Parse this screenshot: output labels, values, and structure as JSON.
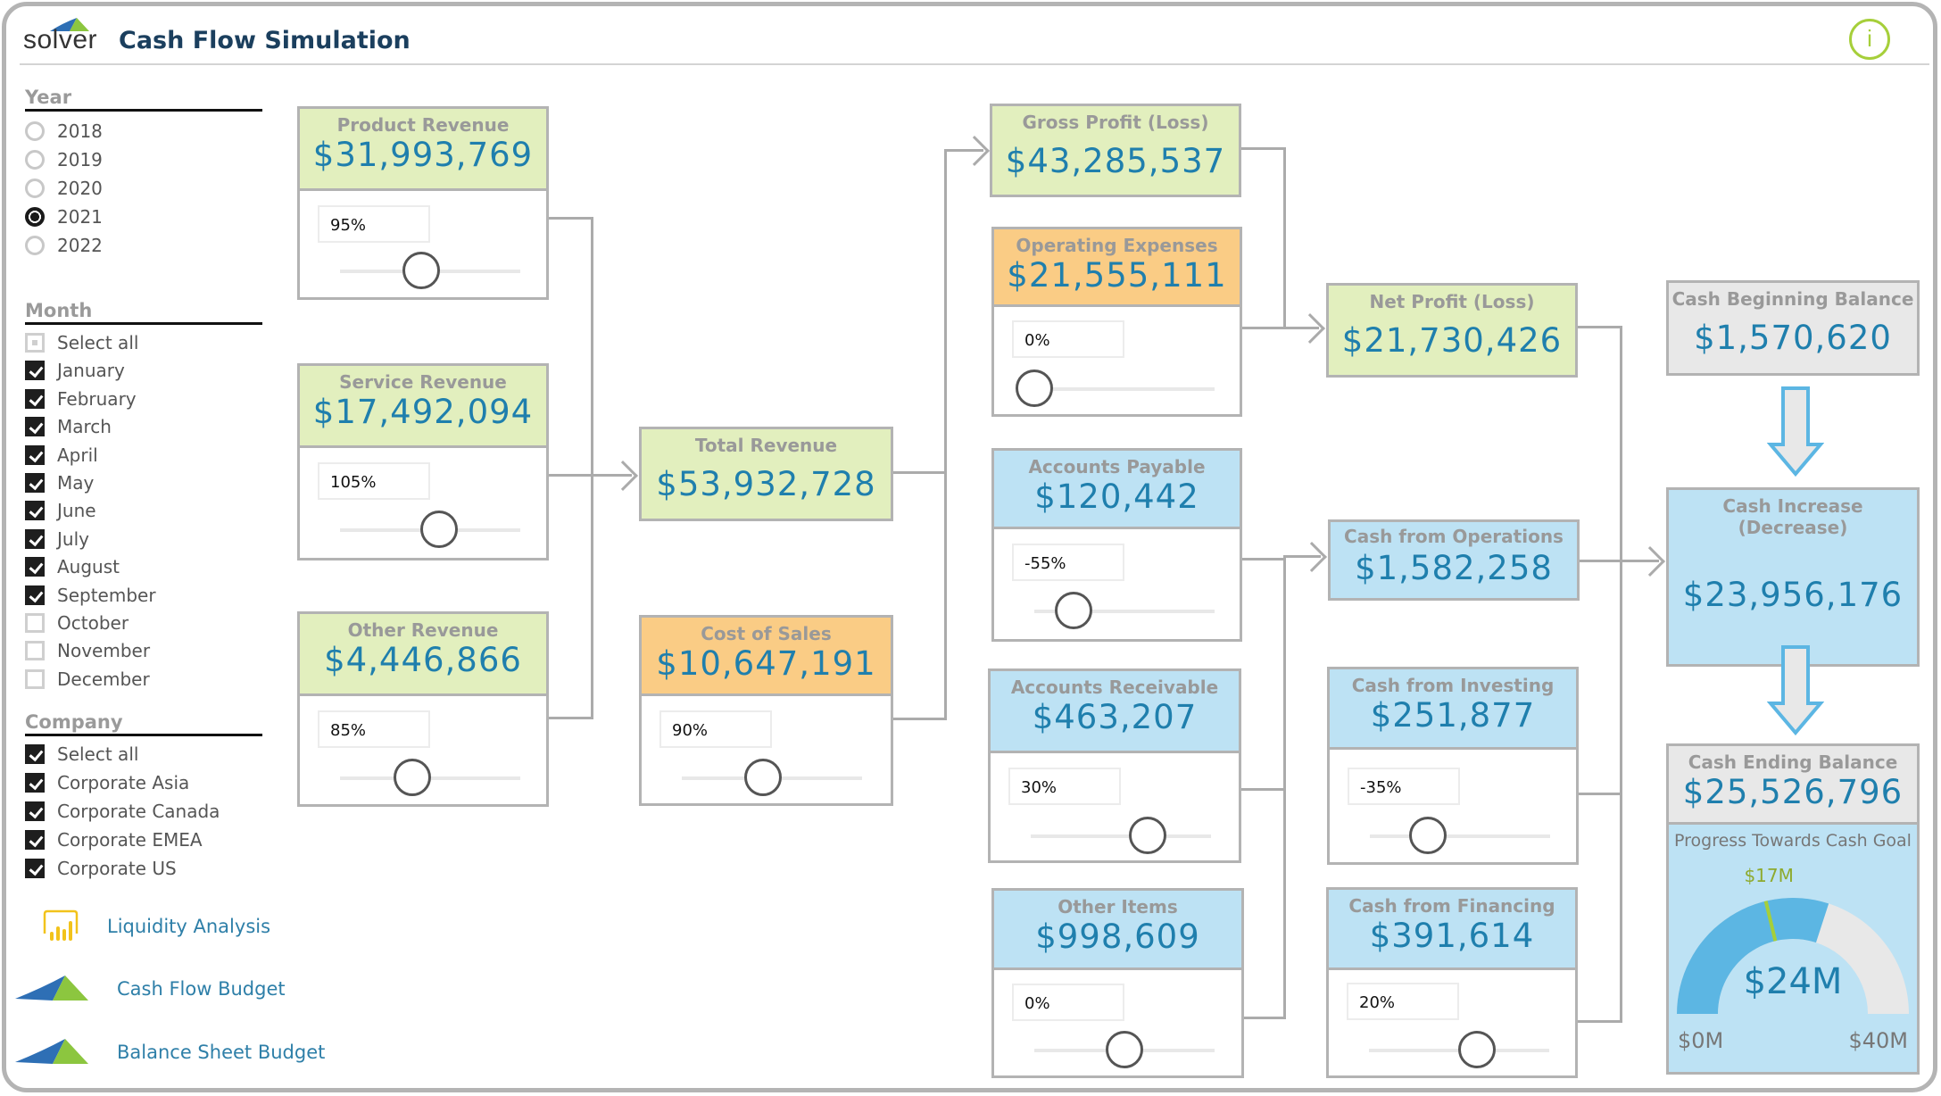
{
  "header": {
    "logo_text": "solver",
    "title": "Cash Flow Simulation",
    "info_icon": "i"
  },
  "filters": {
    "year": {
      "title": "Year",
      "selected": "2021",
      "options": [
        "2018",
        "2019",
        "2020",
        "2021",
        "2022"
      ]
    },
    "month": {
      "title": "Month",
      "options": [
        {
          "label": "Select all",
          "state": "partial"
        },
        {
          "label": "January",
          "state": "checked"
        },
        {
          "label": "February",
          "state": "checked"
        },
        {
          "label": "March",
          "state": "checked"
        },
        {
          "label": "April",
          "state": "checked"
        },
        {
          "label": "May",
          "state": "checked"
        },
        {
          "label": "June",
          "state": "checked"
        },
        {
          "label": "July",
          "state": "checked"
        },
        {
          "label": "August",
          "state": "checked"
        },
        {
          "label": "September",
          "state": "checked"
        },
        {
          "label": "October",
          "state": "unchecked"
        },
        {
          "label": "November",
          "state": "unchecked"
        },
        {
          "label": "December",
          "state": "unchecked"
        }
      ]
    },
    "company": {
      "title": "Company",
      "options": [
        {
          "label": "Select all",
          "state": "checked"
        },
        {
          "label": "Corporate Asia",
          "state": "checked"
        },
        {
          "label": "Corporate Canada",
          "state": "checked"
        },
        {
          "label": "Corporate EMEA",
          "state": "checked"
        },
        {
          "label": "Corporate US",
          "state": "checked"
        }
      ]
    }
  },
  "nav_links": [
    {
      "label": "Liquidity Analysis",
      "icon": "bar-chart-icon"
    },
    {
      "label": "Cash Flow Budget",
      "icon": "solver-logo-icon"
    },
    {
      "label": "Balance Sheet Budget",
      "icon": "solver-logo-icon"
    }
  ],
  "cards": {
    "product_revenue": {
      "label": "Product Revenue",
      "value": "$31,993,769",
      "pct": "95%",
      "slider": 0.45
    },
    "service_revenue": {
      "label": "Service Revenue",
      "value": "$17,492,094",
      "pct": "105%",
      "slider": 0.55
    },
    "other_revenue": {
      "label": "Other Revenue",
      "value": "$4,446,866",
      "pct": "85%",
      "slider": 0.4
    },
    "total_revenue": {
      "label": "Total Revenue",
      "value": "$53,932,728"
    },
    "cost_of_sales": {
      "label": "Cost of Sales",
      "value": "$10,647,191",
      "pct": "90%",
      "slider": 0.45
    },
    "gross_profit": {
      "label": "Gross Profit (Loss)",
      "value": "$43,285,537"
    },
    "operating_expenses": {
      "label": "Operating Expenses",
      "value": "$21,555,111",
      "pct": "0%",
      "slider": 0.0
    },
    "accounts_payable": {
      "label": "Accounts Payable",
      "value": "$120,442",
      "pct": "-55%",
      "slider": 0.22
    },
    "accounts_receivable": {
      "label": "Accounts Receivable",
      "value": "$463,207",
      "pct": "30%",
      "slider": 0.65
    },
    "other_items": {
      "label": "Other Items",
      "value": "$998,609",
      "pct": "0%",
      "slider": 0.5
    },
    "net_profit": {
      "label": "Net Profit (Loss)",
      "value": "$21,730,426"
    },
    "cash_operations": {
      "label": "Cash from Operations",
      "value": "$1,582,258"
    },
    "cash_investing": {
      "label": "Cash from Investing",
      "value": "$251,877",
      "pct": "-35%",
      "slider": 0.32
    },
    "cash_financing": {
      "label": "Cash from Financing",
      "value": "$391,614",
      "pct": "20%",
      "slider": 0.6
    },
    "cash_beginning": {
      "label": "Cash Beginning Balance",
      "value": "$1,570,620"
    },
    "cash_increase": {
      "label": "Cash Increase (Decrease)",
      "value": "$23,956,176"
    },
    "cash_ending": {
      "label": "Cash Ending Balance",
      "value": "$25,526,796"
    }
  },
  "gauge": {
    "title": "Progress Towards Cash Goal",
    "value_label": "$24M",
    "value": 24,
    "min": 0,
    "max": 40,
    "min_label": "$0M",
    "max_label": "$40M",
    "target": 17,
    "target_label": "$17M",
    "colors": {
      "fill": "#5cb6e3",
      "rest": "#e8e8e8",
      "target": "#a6cf3a"
    }
  },
  "colors": {
    "accent_value": "#1f7fad",
    "revenue_bg": "#e2efbe",
    "expense_bg": "#facc85",
    "cash_bg": "#bde2f4",
    "balance_bg": "#e8e8e8",
    "title": "#1b3f5e",
    "info": "#a6cf3a"
  }
}
